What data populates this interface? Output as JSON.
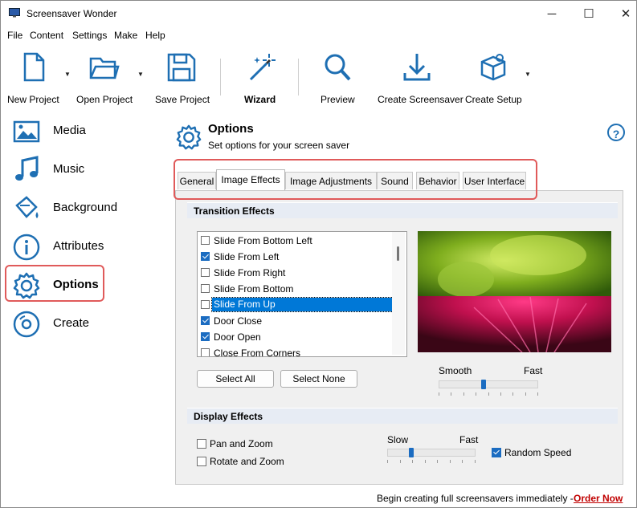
{
  "window": {
    "title": "Screensaver Wonder",
    "controls": {
      "minimize": "─",
      "maximize": "☐",
      "close": "✕"
    }
  },
  "menu": [
    "File",
    "Content",
    "Settings",
    "Make",
    "Help"
  ],
  "toolbar": {
    "new_project": "New Project",
    "open_project": "Open Project",
    "save_project": "Save Project",
    "wizard": "Wizard",
    "preview": "Preview",
    "create_screensaver": "Create Screensaver",
    "create_setup": "Create Setup",
    "accent": "#1e6fb3"
  },
  "sidebar": {
    "items": [
      {
        "label": "Media",
        "icon": "image-icon"
      },
      {
        "label": "Music",
        "icon": "music-note-icon"
      },
      {
        "label": "Background",
        "icon": "paint-bucket-icon"
      },
      {
        "label": "Attributes",
        "icon": "info-icon"
      },
      {
        "label": "Options",
        "icon": "gear-icon",
        "active": true
      },
      {
        "label": "Create",
        "icon": "disc-icon"
      }
    ]
  },
  "header": {
    "title": "Options",
    "subtitle": "Set options for your screen saver",
    "help": "?"
  },
  "tabs": [
    "General",
    "Image Effects",
    "Image Adjustments",
    "Sound",
    "Behavior",
    "User Interface"
  ],
  "active_tab": "Image Effects",
  "transition": {
    "heading": "Transition Effects",
    "items": [
      {
        "label": "Slide From Bottom Left",
        "checked": false
      },
      {
        "label": "Slide From Left",
        "checked": true
      },
      {
        "label": "Slide From Right",
        "checked": false
      },
      {
        "label": "Slide From Bottom",
        "checked": false
      },
      {
        "label": "Slide From Up",
        "checked": false,
        "selected": true
      },
      {
        "label": "Door Close",
        "checked": true
      },
      {
        "label": "Door Open",
        "checked": true
      },
      {
        "label": "Close From Corners",
        "checked": false
      }
    ],
    "select_all": "Select All",
    "select_none": "Select None",
    "speed": {
      "left": "Smooth",
      "right": "Fast",
      "value": 0.45
    }
  },
  "display": {
    "heading": "Display Effects",
    "pan_zoom": {
      "label": "Pan and Zoom",
      "checked": false
    },
    "rotate_zoom": {
      "label": "Rotate and Zoom",
      "checked": false
    },
    "speed": {
      "left": "Slow",
      "right": "Fast",
      "value": 0.25
    },
    "random_speed": {
      "label": "Random Speed",
      "checked": true
    }
  },
  "status": {
    "message": "Begin creating full screensavers immediately - ",
    "link": "Order Now"
  }
}
